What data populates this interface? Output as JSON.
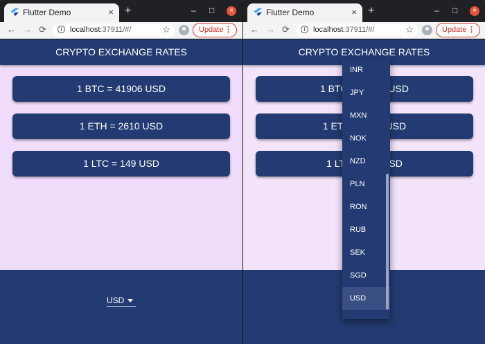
{
  "browser": {
    "tab_title": "Flutter Demo",
    "tab_close": "×",
    "new_tab": "+",
    "url_host": "localhost",
    "url_rest": ":37911/#/",
    "update_label": "Update",
    "update_menu": "⋮",
    "btn_back": "←",
    "btn_forward": "→",
    "btn_reload": "⟳",
    "btn_star": "☆",
    "info": "i",
    "minimize": "–",
    "maximize": "□",
    "close": "×"
  },
  "app": {
    "title": "CRYPTO EXCHANGE RATES",
    "rates": [
      {
        "label": "1 BTC =  41906 USD"
      },
      {
        "label": "1 ETH =  2610 USD"
      },
      {
        "label": "1 LTC =  149 USD"
      }
    ],
    "selected_currency": "USD"
  },
  "dropdown_menu": {
    "items": [
      "INR",
      "JPY",
      "MXN",
      "NOK",
      "NZD",
      "PLN",
      "RON",
      "RUB",
      "SEK",
      "SGD",
      "USD"
    ],
    "selected": "USD"
  },
  "colors": {
    "primary": "#233b72",
    "background": "#f2dcfb",
    "update_red": "#d93025"
  }
}
